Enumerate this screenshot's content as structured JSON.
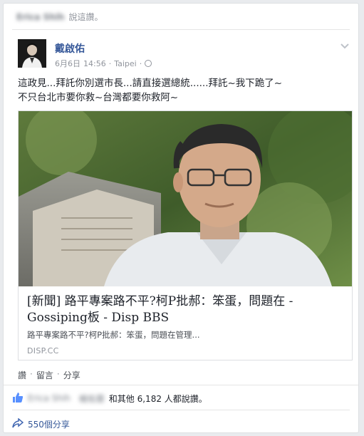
{
  "header": {
    "liked_by_name": "Erica Shih",
    "liked_suffix": "說這讚。"
  },
  "post": {
    "author": "戴啟佑",
    "date": "6月6日",
    "time": "14:56",
    "separator": "·",
    "location": "Taipei",
    "separator2": "·",
    "text_line1": "這政見...拜託你別選市長...請直接選總統......拜託~我下跪了~",
    "text_line2": "不只台北市要你救~台灣都要你救阿~"
  },
  "link": {
    "title": "[新聞] 路平專案路不平?柯P批郝：笨蛋，問題在 - Gossiping板 - Disp BBS",
    "description": "路平專案路不平?柯P批郝：笨蛋，問題在管理...",
    "domain": "DISP.CC"
  },
  "actions": {
    "like": "讚",
    "comment": "留言",
    "share": "分享",
    "dot": "·"
  },
  "likes": {
    "blurred_name1": "Erica Shih",
    "blurred_name2": "楊佑蓉",
    "summary": "和其他 6,182 人都說讚。"
  },
  "shares": {
    "label": "550個分享"
  }
}
